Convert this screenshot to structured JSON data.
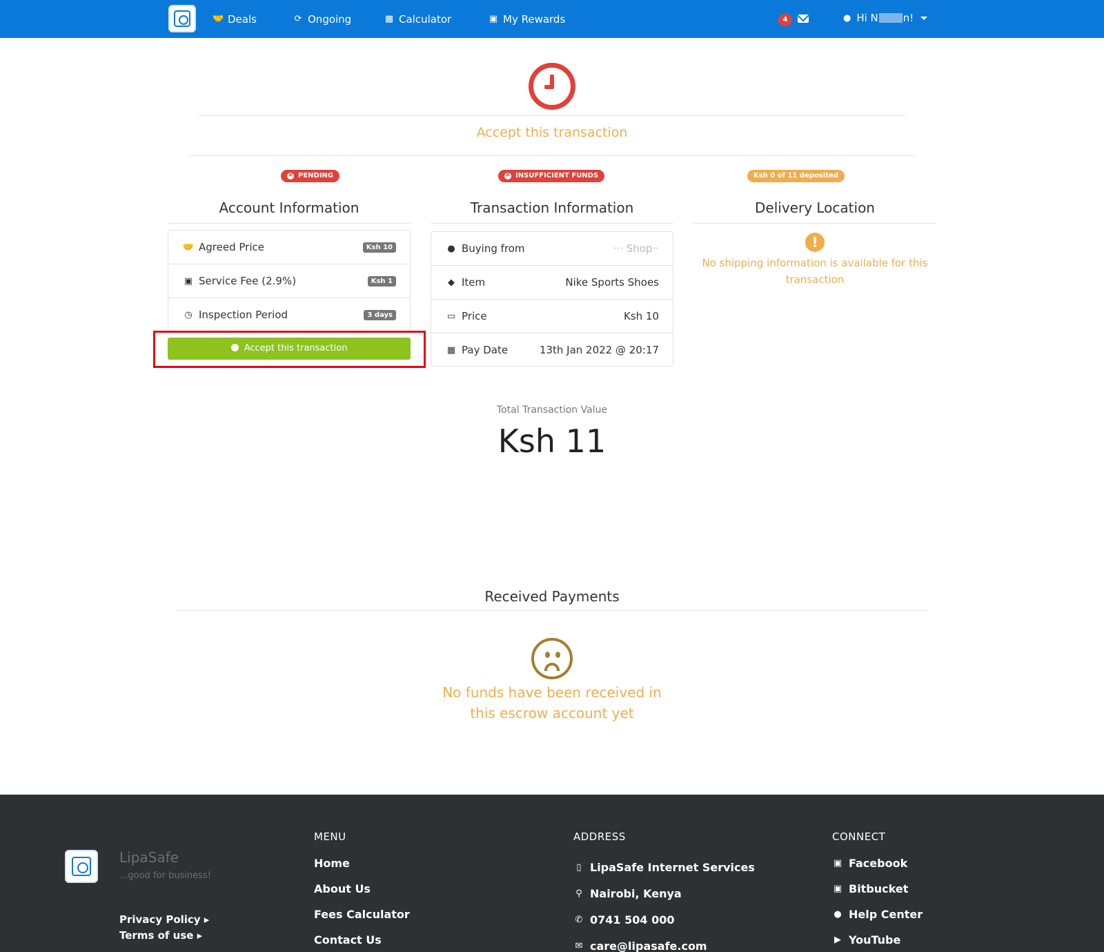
{
  "nav": {
    "deals": "Deals",
    "ongoing": "Ongoing",
    "calculator": "Calculator",
    "rewards": "My Rewards",
    "notification_count": "4",
    "greeting_prefix": "Hi N",
    "greeting_suffix": "n!"
  },
  "header": {
    "title": "Accept this transaction"
  },
  "badges": {
    "pending": "PENDING",
    "funds": "INSUFFICIENT FUNDS",
    "deposited": "Ksh 0 of 11 deposited"
  },
  "account": {
    "title": "Account Information",
    "rows": [
      {
        "label": "Agreed Price",
        "value": "Ksh 10"
      },
      {
        "label": "Service Fee (2.9%)",
        "value": "Ksh 1"
      },
      {
        "label": "Inspection Period",
        "value": "3 days"
      }
    ],
    "accept_button": "Accept this transaction"
  },
  "transaction": {
    "title": "Transaction Information",
    "rows": [
      {
        "label": "Buying from",
        "value": "··· Shop··"
      },
      {
        "label": "Item",
        "value": "Nike Sports Shoes"
      },
      {
        "label": "Price",
        "value": "Ksh 10"
      },
      {
        "label": "Pay Date",
        "value": "13th Jan 2022 @ 20:17"
      }
    ]
  },
  "delivery": {
    "title": "Delivery Location",
    "message": "No shipping information is available for this transaction"
  },
  "total": {
    "label": "Total Transaction Value",
    "value": "Ksh 11"
  },
  "payments": {
    "title": "Received Payments",
    "message": "No funds have been received in this escrow account yet"
  },
  "footer": {
    "brand": "LipaSafe",
    "tagline": "...good for business!",
    "privacy": "Privacy Policy ▸",
    "terms": "Terms of use ▸",
    "menu_head": "MENU",
    "menu": [
      "Home",
      "About Us",
      "Fees Calculator",
      "Contact Us"
    ],
    "address_head": "ADDRESS",
    "address": [
      "LipaSafe Internet Services",
      "Nairobi, Kenya",
      "0741 504 000",
      "care@lipasafe.com"
    ],
    "connect_head": "CONNECT",
    "connect": [
      "Facebook",
      "Bitbucket",
      "Help Center",
      "YouTube"
    ]
  },
  "colors": {
    "nav": "#0b79d9",
    "danger": "#e0413a",
    "warning": "#f0ad4e",
    "success": "#8dc21f",
    "footer": "#2d3134"
  }
}
